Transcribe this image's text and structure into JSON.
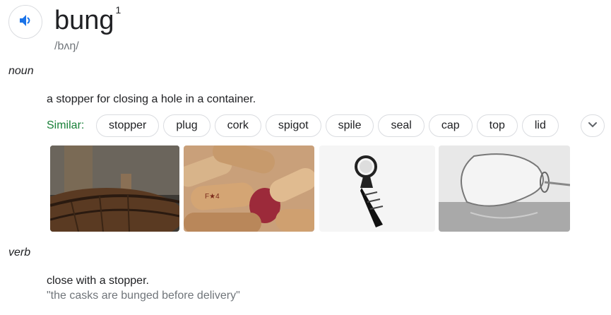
{
  "entry": {
    "word": "bung",
    "homograph": "1",
    "phonetic": "/bʌŋ/",
    "speaker_icon": "speaker-volume-icon"
  },
  "noun": {
    "label": "noun",
    "definition": "a stopper for closing a hole in a container.",
    "similar_label": "Similar:",
    "similar": [
      "stopper",
      "plug",
      "cork",
      "spigot",
      "spile",
      "seal",
      "cap",
      "top",
      "lid"
    ],
    "expand_icon": "chevron-down-icon",
    "images": [
      {
        "subject": "wooden barrel in cellar"
      },
      {
        "subject": "wine corks"
      },
      {
        "subject": "bottle stopper"
      },
      {
        "subject": "tipped wine glass"
      }
    ]
  },
  "verb": {
    "label": "verb",
    "definition": "close with a stopper.",
    "example": "\"the casks are bunged before delivery\""
  },
  "colors": {
    "accent_blue": "#1a73e8",
    "similar_green": "#188038",
    "secondary_text": "#70757a",
    "chip_border": "#dadce0"
  }
}
